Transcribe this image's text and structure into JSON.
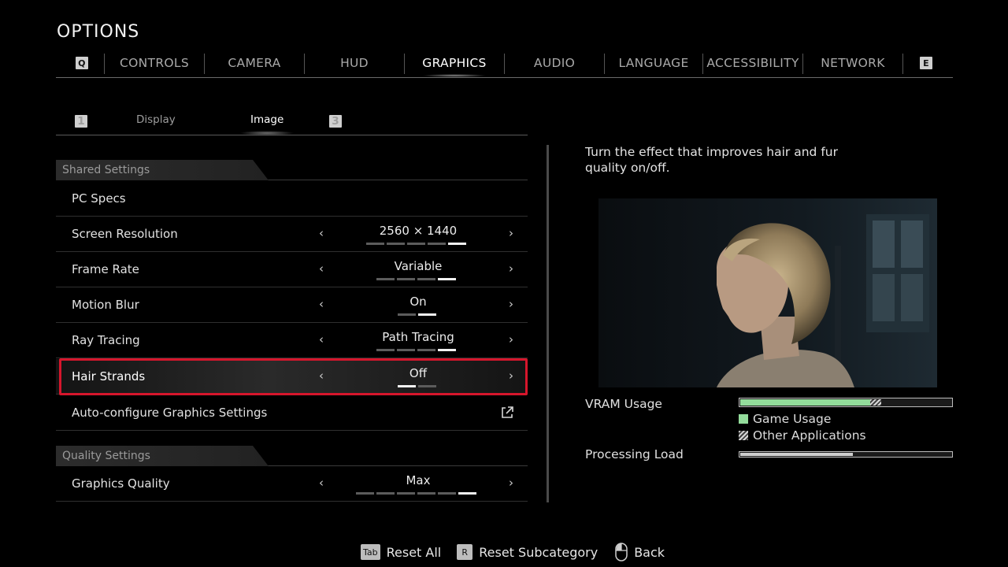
{
  "title": "OPTIONS",
  "tabs": {
    "prev_key": "Q",
    "next_key": "E",
    "items": [
      {
        "label": "CONTROLS"
      },
      {
        "label": "CAMERA"
      },
      {
        "label": "HUD"
      },
      {
        "label": "GRAPHICS",
        "active": true
      },
      {
        "label": "AUDIO"
      },
      {
        "label": "LANGUAGE"
      },
      {
        "label": "ACCESSIBILITY"
      },
      {
        "label": "NETWORK"
      }
    ]
  },
  "subtabs": {
    "prev_key": "1",
    "next_key": "3",
    "items": [
      {
        "label": "Display"
      },
      {
        "label": "Image",
        "active": true
      }
    ]
  },
  "sections": {
    "shared": "Shared Settings",
    "quality": "Quality Settings"
  },
  "settings": {
    "pc_specs": {
      "label": "PC Specs"
    },
    "screen_resolution": {
      "label": "Screen Resolution",
      "value": "2560 × 1440",
      "option_count": 5,
      "selected_index": 5
    },
    "frame_rate": {
      "label": "Frame Rate",
      "value": "Variable",
      "option_count": 4,
      "selected_index": 4
    },
    "motion_blur": {
      "label": "Motion Blur",
      "value": "On",
      "option_count": 2,
      "selected_index": 2
    },
    "ray_tracing": {
      "label": "Ray Tracing",
      "value": "Path Tracing",
      "option_count": 4,
      "selected_index": 4
    },
    "hair_strands": {
      "label": "Hair Strands",
      "value": "Off",
      "option_count": 2,
      "selected_index": 1,
      "selected_row": true
    },
    "auto_configure": {
      "label": "Auto-configure Graphics Settings"
    },
    "graphics_quality": {
      "label": "Graphics Quality",
      "value": "Max",
      "option_count": 6,
      "selected_index": 6
    }
  },
  "description": "Turn the effect that improves hair and fur quality on/off.",
  "vram": {
    "label": "VRAM Usage",
    "game_fraction": 0.61,
    "other_fraction": 0.05,
    "legend_game": "Game Usage",
    "legend_other": "Other Applications",
    "game_color": "#93dc9b"
  },
  "processing_load": {
    "label": "Processing Load",
    "fraction": 0.53
  },
  "footer": {
    "reset_all_key": "Tab",
    "reset_all": "Reset All",
    "reset_sub_key": "R",
    "reset_sub": "Reset Subcategory",
    "back": "Back"
  },
  "colors": {
    "selection_border": "#d6162c",
    "accent": "#ffffff"
  }
}
